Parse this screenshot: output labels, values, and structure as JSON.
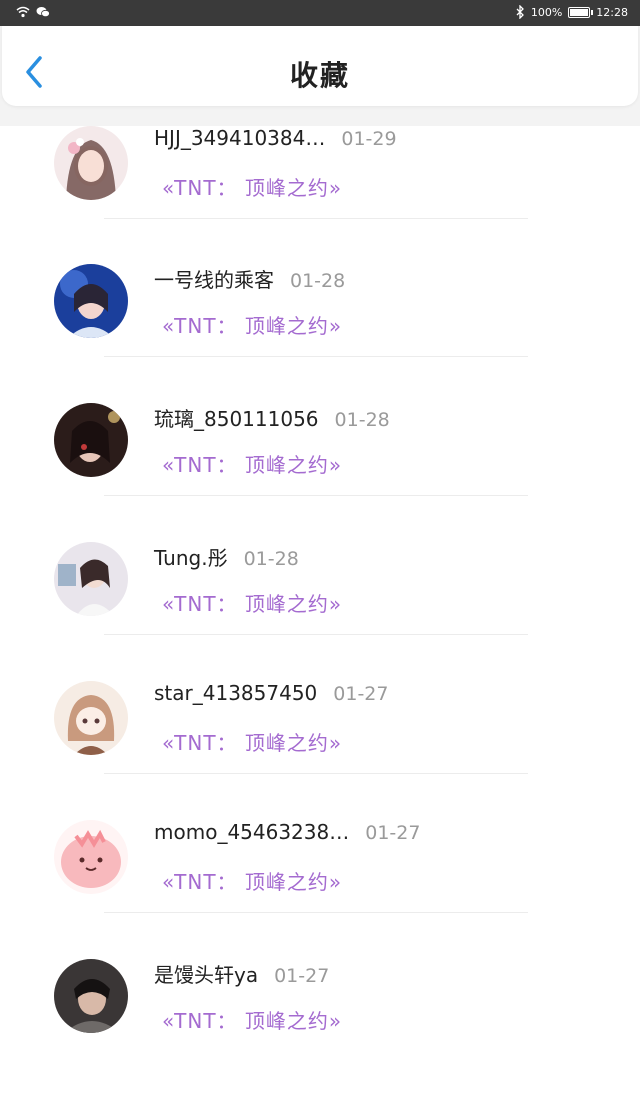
{
  "status_bar": {
    "battery": "100%",
    "time": "12:28",
    "battery_level": 1.0
  },
  "header": {
    "title": "收藏",
    "back_icon": "chevron-left-icon"
  },
  "colors": {
    "accent": "#2a8fe0",
    "work_link": "#a46bd0",
    "date": "#9a9a9a"
  },
  "favorites": [
    {
      "user": "HJJ_349410384…",
      "date": "01-29",
      "work": "«TNT： 顶峰之约»"
    },
    {
      "user": "一号线的乘客",
      "date": "01-28",
      "work": "«TNT： 顶峰之约»"
    },
    {
      "user": "琉璃_850111056",
      "date": "01-28",
      "work": "«TNT： 顶峰之约»"
    },
    {
      "user": "Tung.彤",
      "date": "01-28",
      "work": "«TNT： 顶峰之约»"
    },
    {
      "user": "star_413857450",
      "date": "01-27",
      "work": "«TNT： 顶峰之约»"
    },
    {
      "user": "momo_45463238…",
      "date": "01-27",
      "work": "«TNT： 顶峰之约»"
    },
    {
      "user": "是馒头轩ya",
      "date": "01-27",
      "work": "«TNT： 顶峰之约»"
    }
  ]
}
